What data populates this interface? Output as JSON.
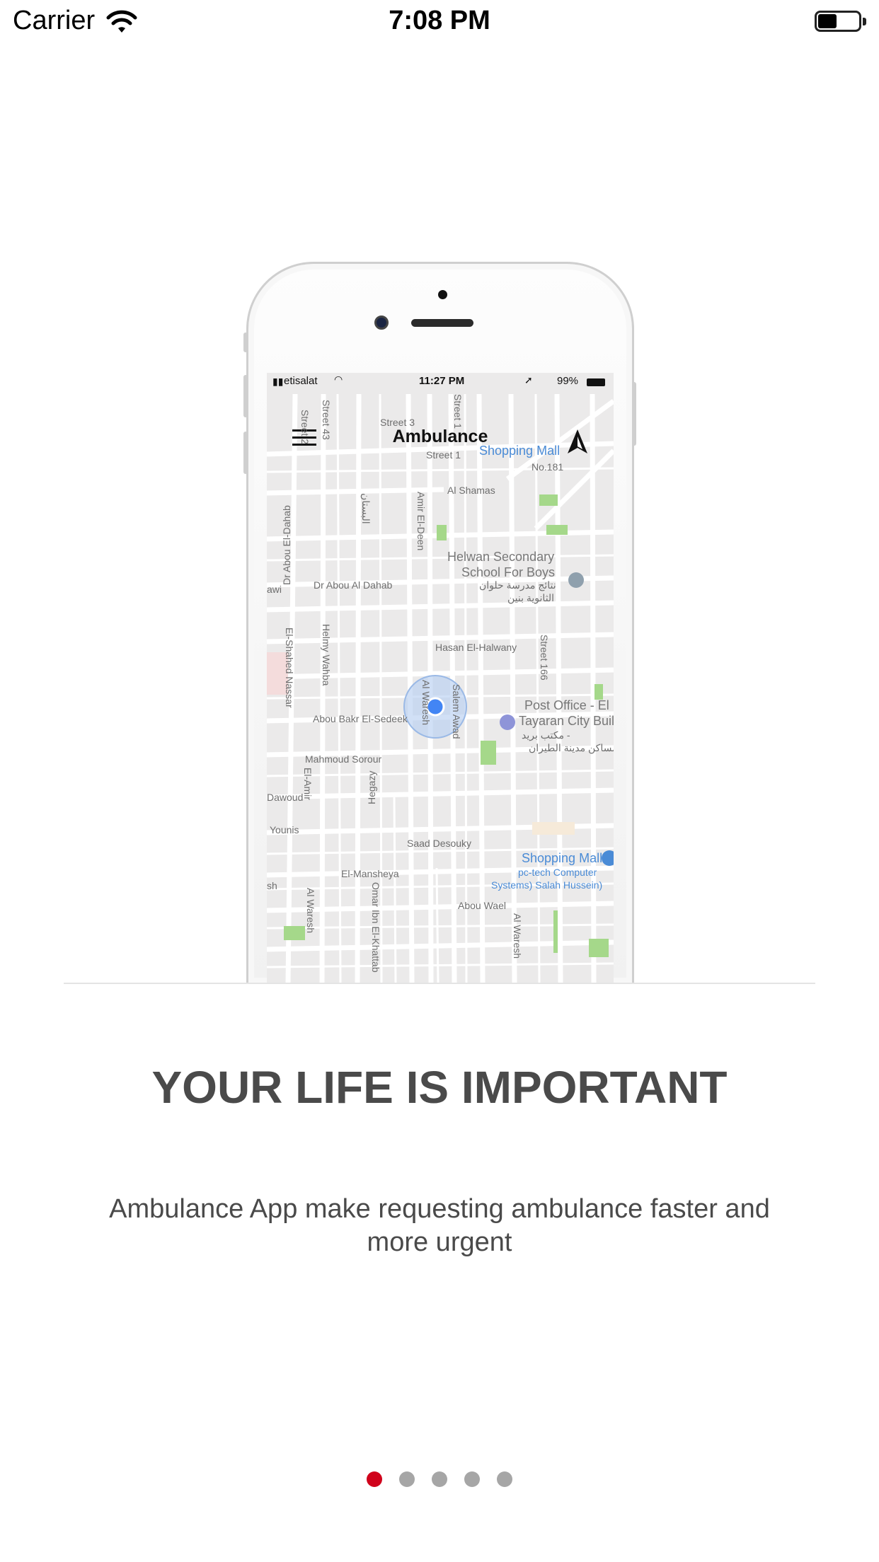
{
  "status_bar": {
    "carrier": "Carrier",
    "time": "7:08 PM"
  },
  "illustration": {
    "status_carrier": "etisalat",
    "status_time": "11:27 PM",
    "status_battery": "99%",
    "app_title": "Ambulance",
    "map_labels": {
      "street2": "Street 2",
      "street43": "Street 43",
      "street3": "Street 3",
      "street1": "Street 1",
      "street1v": "Street 1",
      "shopping_mall_top": "Shopping Mall",
      "no181": "No.181",
      "al_shamas": "Al Shamas",
      "amir_el_deen": "Amir El-Deen",
      "dr_abou_el_dahab": "Dr Abou El-Dahab",
      "arabic_bustan": "البستان",
      "helwan_school_1": "Helwan Secondary",
      "helwan_school_2": "School For Boys",
      "helwan_ar_1": "نتائج مدرسة حلوان",
      "helwan_ar_2": "الثانوية بنين",
      "awi": "awi",
      "dr_abou_al_dahab": "Dr Abou Al Dahab",
      "hasan_el_halwany": "Hasan El-Halwany",
      "street166": "Street 166",
      "el_shahed_nassar": "El-Shahed Nassar",
      "helmy_wahba": "Helmy Wahba",
      "al_waresh": "Al Waresh",
      "salem_awad": "Salem Awad",
      "post_office_1": "Post Office - El",
      "post_office_2": "Tayaran City Buil",
      "post_ar_1": "مكتب بريد -",
      "post_ar_2": "مساكن مدينة الطيران",
      "abou_bakr": "Abou Bakr El-Sedeek",
      "mahmoud_sorour": "Mahmoud Sorour",
      "el_amir": "El-Amir",
      "hegazy": "Hegazy",
      "dawoud": "Dawoud",
      "younis": "Younis",
      "saad_desouky": "Saad Desouky",
      "shopping_mall_bottom": "Shopping Mall",
      "pc_tech_1": "pc-tech Computer",
      "pc_tech_2": "Systems) Salah Hussein)",
      "el_mansheya": "El-Mansheya",
      "sh": "sh",
      "al_waresh_2": "Al Waresh",
      "omar_ibn_el_khattab": "Omar Ibn El-Khattab",
      "abou_wael": "Abou Wael",
      "al_waresh_3": "Al Waresh"
    }
  },
  "onboarding": {
    "headline": "YOUR LIFE IS IMPORTANT",
    "subtitle": "Ambulance App make requesting ambulance faster and more urgent",
    "page_count": 5,
    "current_page": 1
  },
  "colors": {
    "active_dot": "#d0021b",
    "inactive_dot": "#a6a6a6",
    "text": "#4a4a4a"
  }
}
